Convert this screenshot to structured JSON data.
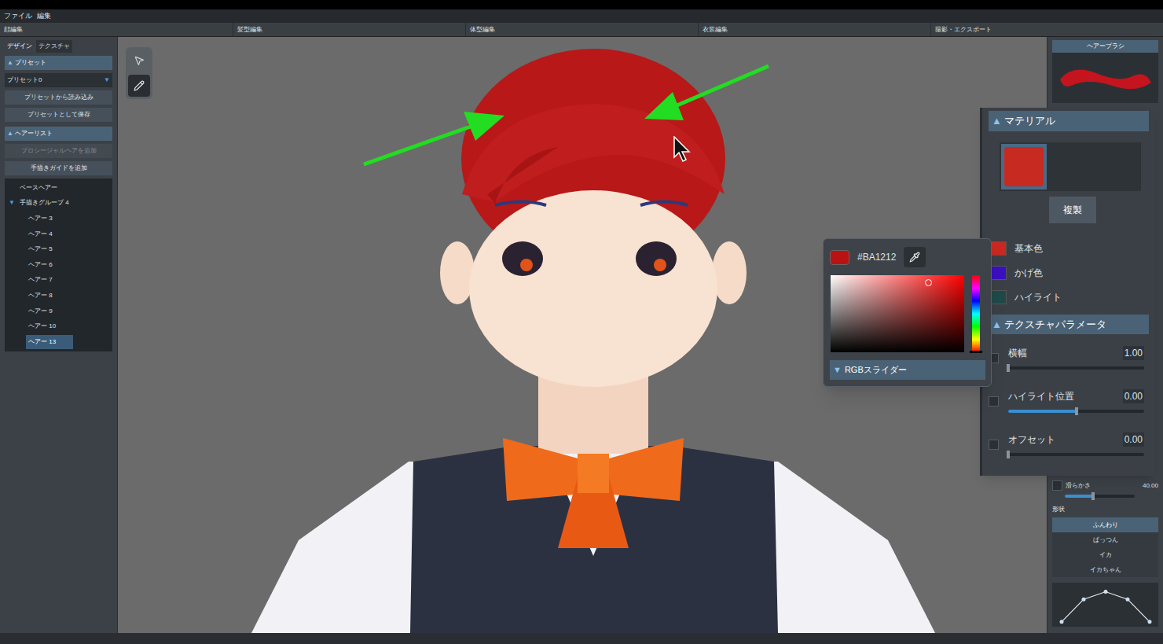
{
  "menu": [
    "ファイル",
    "編集"
  ],
  "modes": [
    {
      "label": "顔編集"
    },
    {
      "label": "髪型編集"
    },
    {
      "label": "体型編集"
    },
    {
      "label": "衣装編集"
    },
    {
      "label": "撮影・エクスポート"
    }
  ],
  "left_panel": {
    "tabs": [
      {
        "label": "デザイン",
        "selected": true
      },
      {
        "label": "テクスチャ",
        "selected": false
      }
    ],
    "preset_section": {
      "icon": "▲",
      "title": "プリセット",
      "dropdown": {
        "value": "プリセット0",
        "arrow": "▼"
      },
      "buttons": [
        "プリセットから読み込み",
        "プリセットとして保存"
      ]
    },
    "hair_section": {
      "icon": "▲",
      "title": "ヘアーリスト",
      "buttons": [
        {
          "label": "プロシージャルヘアを追加",
          "disabled": true
        },
        {
          "label": "手描きガイドを追加",
          "disabled": false
        }
      ],
      "tree": [
        {
          "kind": "root",
          "label": "ベースヘアー",
          "selected": false
        },
        {
          "kind": "group",
          "label": "手描きグループ 4",
          "toggle": "▼",
          "expanded": true,
          "selected": false
        },
        {
          "kind": "child",
          "label": "ヘアー 3",
          "selected": false
        },
        {
          "kind": "child",
          "label": "ヘアー 4",
          "selected": false
        },
        {
          "kind": "child",
          "label": "ヘアー 5",
          "selected": false
        },
        {
          "kind": "child",
          "label": "ヘアー 6",
          "selected": false
        },
        {
          "kind": "child",
          "label": "ヘアー 7",
          "selected": false
        },
        {
          "kind": "child",
          "label": "ヘアー 8",
          "selected": false
        },
        {
          "kind": "child",
          "label": "ヘアー 9",
          "selected": false
        },
        {
          "kind": "child",
          "label": "ヘアー 10",
          "selected": false
        },
        {
          "kind": "child",
          "label": "ヘアー 13",
          "selected": true
        }
      ]
    }
  },
  "tools": [
    {
      "kind": "select",
      "selected": false
    },
    {
      "kind": "pen",
      "selected": true
    }
  ],
  "brush_panel": {
    "title": "ヘアーブラシ"
  },
  "material_panel": {
    "icon": "▲",
    "title": "マテリアル",
    "swatch_color": "#c62a20",
    "button": "複製",
    "colors": [
      {
        "label": "基本色",
        "color": "#c8281f"
      },
      {
        "label": "かげ色",
        "color": "#3a10c0"
      },
      {
        "label": "ハイライト",
        "color": "#1f4a4a"
      }
    ]
  },
  "texture_params": {
    "icon": "▲",
    "title": "テクスチャパラメータ",
    "params": [
      {
        "label": "横幅",
        "value": "1.00",
        "level": 0.0,
        "checked": false
      },
      {
        "label": "ハイライト位置",
        "value": "0.00",
        "level": 0.5,
        "checked": false
      },
      {
        "label": "オフセット",
        "value": "0.00",
        "level": 0.0,
        "checked": false
      }
    ]
  },
  "color_picker": {
    "hex": "#BA1212",
    "color": "#ba1212",
    "hue_color": "#ff0000",
    "saturation": 0.73,
    "value": 0.91,
    "hue": 0.0,
    "toggle": "▼",
    "section": "RGBスライダー"
  },
  "smoothness": {
    "label": "滑らかさ",
    "value": "40.00",
    "level": 0.4,
    "checked": false
  },
  "shape": {
    "label": "形状",
    "options": [
      {
        "label": "ふんわり",
        "selected": true
      },
      {
        "label": "ぱっつん",
        "selected": false
      },
      {
        "label": "イカ",
        "selected": false
      },
      {
        "label": "イカちゃん",
        "selected": false
      }
    ],
    "curve": [
      0.05,
      0.7,
      0.92,
      0.7,
      0.05
    ]
  }
}
